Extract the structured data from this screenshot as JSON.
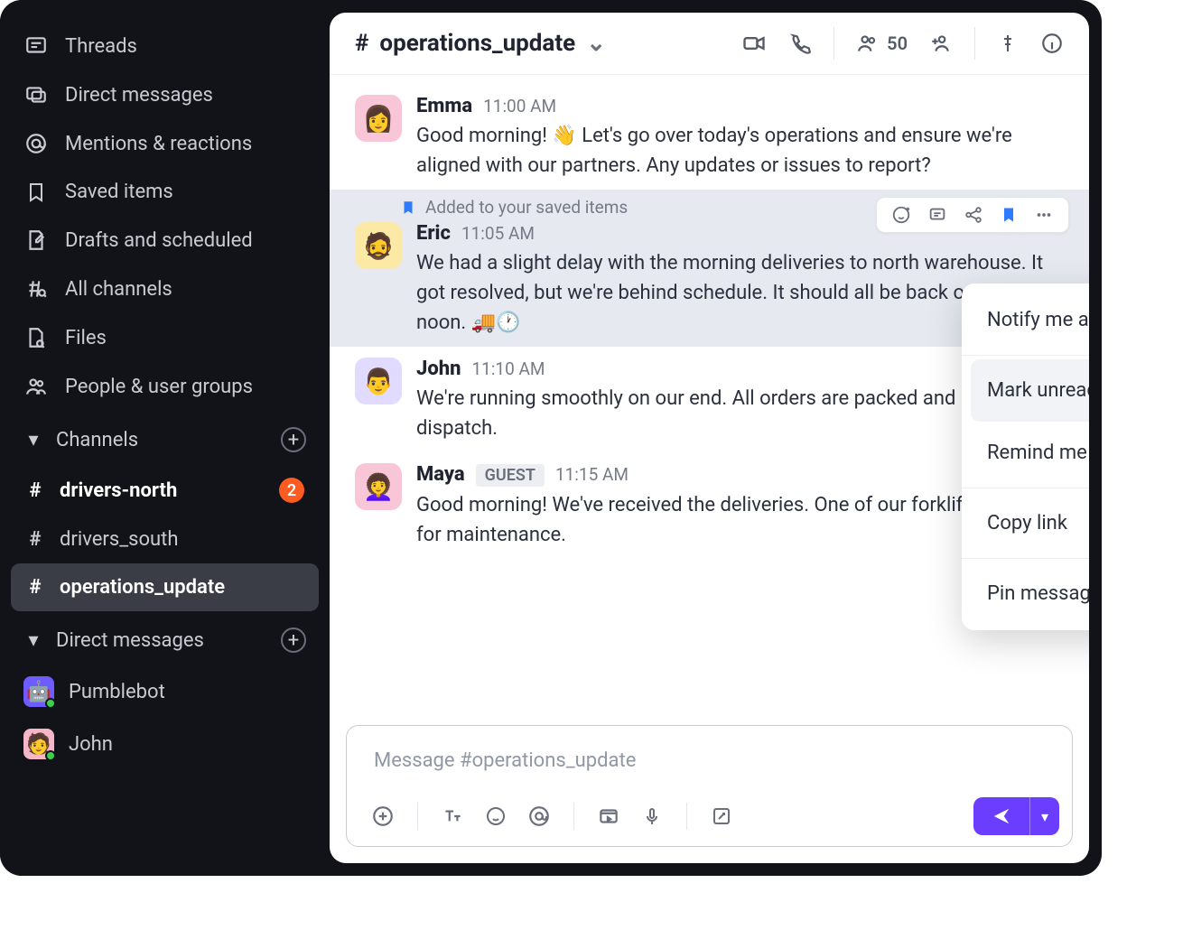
{
  "sidebar": {
    "nav": [
      {
        "icon": "threads",
        "label": "Threads"
      },
      {
        "icon": "dm",
        "label": "Direct messages"
      },
      {
        "icon": "mentions",
        "label": "Mentions & reactions"
      },
      {
        "icon": "saved",
        "label": "Saved items"
      },
      {
        "icon": "drafts",
        "label": "Drafts and scheduled"
      },
      {
        "icon": "all-channels",
        "label": "All channels"
      },
      {
        "icon": "files",
        "label": "Files"
      },
      {
        "icon": "people",
        "label": "People & user groups"
      }
    ],
    "channels_heading": "Channels",
    "channels": [
      {
        "name": "drivers-north",
        "unread": 2,
        "bold": true
      },
      {
        "name": "drivers_south"
      },
      {
        "name": "operations_update",
        "active": true
      }
    ],
    "dm_heading": "Direct messages",
    "dms": [
      {
        "name": "Pumblebot"
      },
      {
        "name": "John"
      }
    ]
  },
  "header": {
    "channel": "operations_update",
    "member_count": "50"
  },
  "saved_banner": "Added to your saved items",
  "messages": [
    {
      "sender": "Emma",
      "time": "11:00 AM",
      "avatar": "av1",
      "text": "Good morning! 👋 Let's go over today's operations and ensure we're aligned with our partners. Any updates or issues to report?"
    },
    {
      "sender": "Eric",
      "time": "11:05 AM",
      "avatar": "av2",
      "saved": true,
      "text": "We had a slight delay with the morning deliveries to north warehouse. It got resolved, but we're behind schedule. It should all be back on track by noon. 🚚🕐"
    },
    {
      "sender": "John",
      "time": "11:10 AM",
      "avatar": "av3",
      "text": "We're running smoothly on our end. All orders are packed and ready for dispatch."
    },
    {
      "sender": "Maya",
      "time": "11:15 AM",
      "avatar": "av4",
      "guest": true,
      "text": "Good morning! We've received the deliveries. One of our forklifts is down for maintenance."
    }
  ],
  "guest_label": "GUEST",
  "context_menu": {
    "items": [
      {
        "label": "Notify me about new replies"
      },
      {
        "sep": true
      },
      {
        "label": "Mark unread",
        "hover": true
      },
      {
        "label": "Remind me about this",
        "chevron": true
      },
      {
        "sep": true
      },
      {
        "label": "Copy link"
      },
      {
        "sep": true
      },
      {
        "label": "Pin message"
      }
    ]
  },
  "composer": {
    "placeholder": "Message #operations_update"
  }
}
